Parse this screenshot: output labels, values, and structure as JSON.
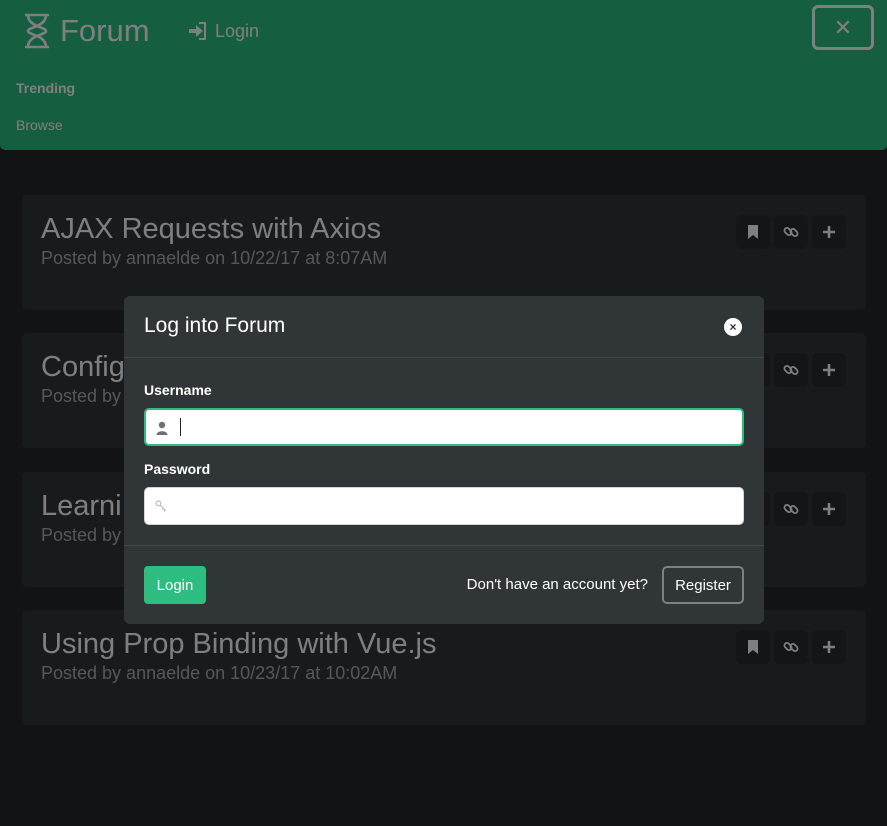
{
  "navbar": {
    "brand": "Forum",
    "login_label": "Login",
    "close_glyph": "✕",
    "links": [
      "Trending",
      "Browse"
    ],
    "accent_color": "#2dbd80"
  },
  "posts": [
    {
      "title": "AJAX Requests with Axios",
      "meta": "Posted by annaelde on 10/22/17 at 8:07AM"
    },
    {
      "title": "Config",
      "meta": "Posted by"
    },
    {
      "title": "Learni",
      "meta": "Posted by"
    },
    {
      "title": "Using Prop Binding with Vue.js",
      "meta": "Posted by annaelde on 10/23/17 at 10:02AM"
    }
  ],
  "post_actions": [
    "bookmark-icon",
    "link-icon",
    "plus-icon"
  ],
  "modal": {
    "title": "Log into Forum",
    "close_glyph": "×",
    "username_label": "Username",
    "username_value": "",
    "password_label": "Password",
    "password_value": "",
    "login_button": "Login",
    "no_account_text": "Don't have an account yet?",
    "register_button": "Register"
  },
  "icons": {
    "brand": "hourglass-icon",
    "nav_login": "sign-in-icon",
    "username": "user-icon",
    "password": "key-icon"
  }
}
